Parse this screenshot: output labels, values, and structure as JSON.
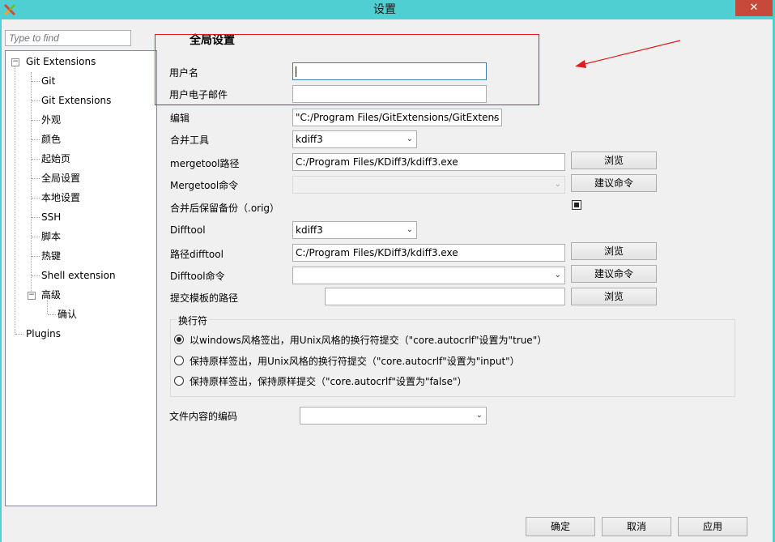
{
  "window": {
    "title": "设置",
    "close_glyph": "✕",
    "app_icon": "git-extensions-logo"
  },
  "search": {
    "placeholder": "Type to find"
  },
  "tree": {
    "root": "Git Extensions",
    "children": [
      "Git",
      "Git Extensions",
      "外观",
      "颜色",
      "起始页",
      "全局设置",
      "本地设置",
      "SSH",
      "脚本",
      "热键",
      "Shell extension",
      "高级"
    ],
    "advanced_children": [
      "确认"
    ],
    "plugins": "Plugins",
    "expander_glyph": "−"
  },
  "panel": {
    "heading": "全局设置",
    "user_name": {
      "label": "用户名",
      "value": ""
    },
    "user_email": {
      "label": "用户电子邮件",
      "value": ""
    },
    "editor": {
      "label": "编辑",
      "value": "\"C:/Program Files/GitExtensions/GitExtens"
    },
    "mergetool": {
      "label": "合并工具",
      "value": "kdiff3"
    },
    "mergetool_path": {
      "label": "mergetool路径",
      "value": "C:/Program Files/KDiff3/kdiff3.exe",
      "browse": "浏览"
    },
    "mergetool_cmd": {
      "label": "Mergetool命令",
      "value": "",
      "suggest": "建议命令"
    },
    "keep_backup": {
      "label": "合并后保留备份（.orig）",
      "checked": true
    },
    "difftool": {
      "label": "Difftool",
      "value": "kdiff3"
    },
    "difftool_path": {
      "label": "路径difftool",
      "value": "C:/Program Files/KDiff3/kdiff3.exe",
      "browse": "浏览"
    },
    "difftool_cmd": {
      "label": "Difftool命令",
      "value": "",
      "suggest": "建议命令"
    },
    "commit_template": {
      "label": "提交模板的路径",
      "value": "",
      "browse": "浏览"
    },
    "line_endings": {
      "title": "换行符",
      "options": [
        "以windows风格签出，用Unix风格的换行符提交（\"core.autocrlf\"设置为\"true\"）",
        "保持原样签出，用Unix风格的换行符提交（\"core.autocrlf\"设置为\"input\"）",
        "保持原样签出，保持原样提交（\"core.autocrlf\"设置为\"false\"）"
      ],
      "selected_index": 0
    },
    "file_encoding": {
      "label": "文件内容的编码",
      "value": ""
    }
  },
  "dropdown_glyph": "⌄",
  "footer": {
    "ok": "确定",
    "cancel": "取消",
    "apply": "应用"
  },
  "annotation": {
    "color": "#e21b1b"
  }
}
